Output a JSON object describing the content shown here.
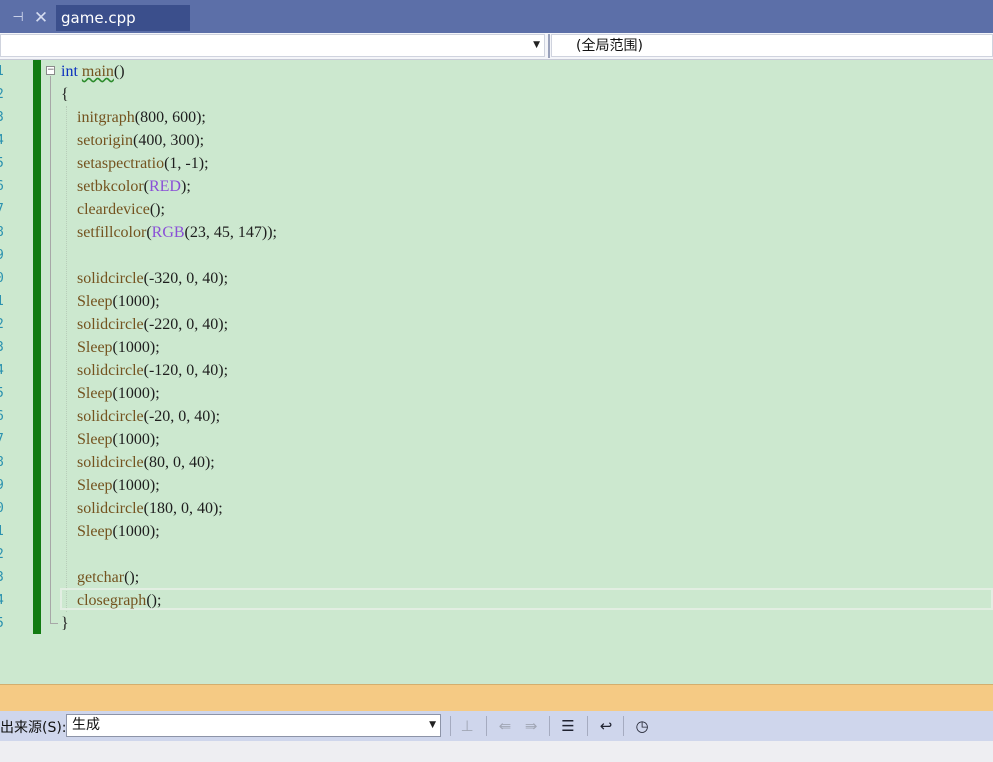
{
  "tabs": {
    "pin_icon": "pin-icon",
    "close_icon": "close-icon",
    "active_label": "game.cpp"
  },
  "navbar": {
    "left_value": "",
    "right_value": "(全局范围)"
  },
  "editor": {
    "line_numbers": [
      "1",
      "2",
      "3",
      "4",
      "5",
      "6",
      "7",
      "8",
      "9",
      "0",
      "1",
      "2",
      "3",
      "4",
      "5",
      "6",
      "7",
      "8",
      "9",
      "0",
      "1",
      "2",
      "3",
      "4",
      "5"
    ],
    "lines": [
      [
        [
          "kw",
          "int"
        ],
        [
          "p",
          " "
        ],
        [
          "fn squig",
          "main"
        ],
        [
          "p",
          "()"
        ]
      ],
      [
        [
          "p",
          "{"
        ]
      ],
      [
        [
          "p",
          "    "
        ],
        [
          "fn",
          "initgraph"
        ],
        [
          "p",
          "(800, 600);"
        ]
      ],
      [
        [
          "p",
          "    "
        ],
        [
          "fn",
          "setorigin"
        ],
        [
          "p",
          "(400, 300);"
        ]
      ],
      [
        [
          "p",
          "    "
        ],
        [
          "fn",
          "setaspectratio"
        ],
        [
          "p",
          "(1, -1);"
        ]
      ],
      [
        [
          "p",
          "    "
        ],
        [
          "fn",
          "setbkcolor"
        ],
        [
          "p",
          "("
        ],
        [
          "mac",
          "RED"
        ],
        [
          "p",
          ");"
        ]
      ],
      [
        [
          "p",
          "    "
        ],
        [
          "fn",
          "cleardevice"
        ],
        [
          "p",
          "();"
        ]
      ],
      [
        [
          "p",
          "    "
        ],
        [
          "fn",
          "setfillcolor"
        ],
        [
          "p",
          "("
        ],
        [
          "mac",
          "RGB"
        ],
        [
          "p",
          "(23, 45, 147));"
        ]
      ],
      [],
      [
        [
          "p",
          "    "
        ],
        [
          "fn",
          "solidcircle"
        ],
        [
          "p",
          "(-320, 0, 40);"
        ]
      ],
      [
        [
          "p",
          "    "
        ],
        [
          "fn",
          "Sleep"
        ],
        [
          "p",
          "(1000);"
        ]
      ],
      [
        [
          "p",
          "    "
        ],
        [
          "fn",
          "solidcircle"
        ],
        [
          "p",
          "(-220, 0, 40);"
        ]
      ],
      [
        [
          "p",
          "    "
        ],
        [
          "fn",
          "Sleep"
        ],
        [
          "p",
          "(1000);"
        ]
      ],
      [
        [
          "p",
          "    "
        ],
        [
          "fn",
          "solidcircle"
        ],
        [
          "p",
          "(-120, 0, 40);"
        ]
      ],
      [
        [
          "p",
          "    "
        ],
        [
          "fn",
          "Sleep"
        ],
        [
          "p",
          "(1000);"
        ]
      ],
      [
        [
          "p",
          "    "
        ],
        [
          "fn",
          "solidcircle"
        ],
        [
          "p",
          "(-20, 0, 40);"
        ]
      ],
      [
        [
          "p",
          "    "
        ],
        [
          "fn",
          "Sleep"
        ],
        [
          "p",
          "(1000);"
        ]
      ],
      [
        [
          "p",
          "    "
        ],
        [
          "fn",
          "solidcircle"
        ],
        [
          "p",
          "(80, 0, 40);"
        ]
      ],
      [
        [
          "p",
          "    "
        ],
        [
          "fn",
          "Sleep"
        ],
        [
          "p",
          "(1000);"
        ]
      ],
      [
        [
          "p",
          "    "
        ],
        [
          "fn",
          "solidcircle"
        ],
        [
          "p",
          "(180, 0, 40);"
        ]
      ],
      [
        [
          "p",
          "    "
        ],
        [
          "fn",
          "Sleep"
        ],
        [
          "p",
          "(1000);"
        ]
      ],
      [],
      [
        [
          "p",
          "    "
        ],
        [
          "fn",
          "getchar"
        ],
        [
          "p",
          "();"
        ]
      ],
      [
        [
          "p",
          "    "
        ],
        [
          "fn",
          "closegraph"
        ],
        [
          "p",
          "();"
        ]
      ],
      [
        [
          "p",
          "}"
        ]
      ]
    ],
    "current_line": 24,
    "colors": {
      "background": "#cce8cf",
      "keyword": "#0a2fbf",
      "function": "#74531f",
      "macro": "#8a4fd7",
      "change_bar": "#117b11"
    }
  },
  "output": {
    "source_label": "出来源(S):",
    "source_value": "生成",
    "buttons": [
      {
        "name": "find-message-icon",
        "glyph": "⊥",
        "enabled": false
      },
      {
        "name": "previous-message-icon",
        "glyph": "⇚",
        "enabled": false
      },
      {
        "name": "next-message-icon",
        "glyph": "⇛",
        "enabled": false
      },
      {
        "name": "clear-all-icon",
        "glyph": "☰",
        "enabled": true
      },
      {
        "name": "word-wrap-icon",
        "glyph": "↩",
        "enabled": true
      },
      {
        "name": "timestamp-clock-icon",
        "glyph": "◷",
        "enabled": true
      }
    ]
  }
}
